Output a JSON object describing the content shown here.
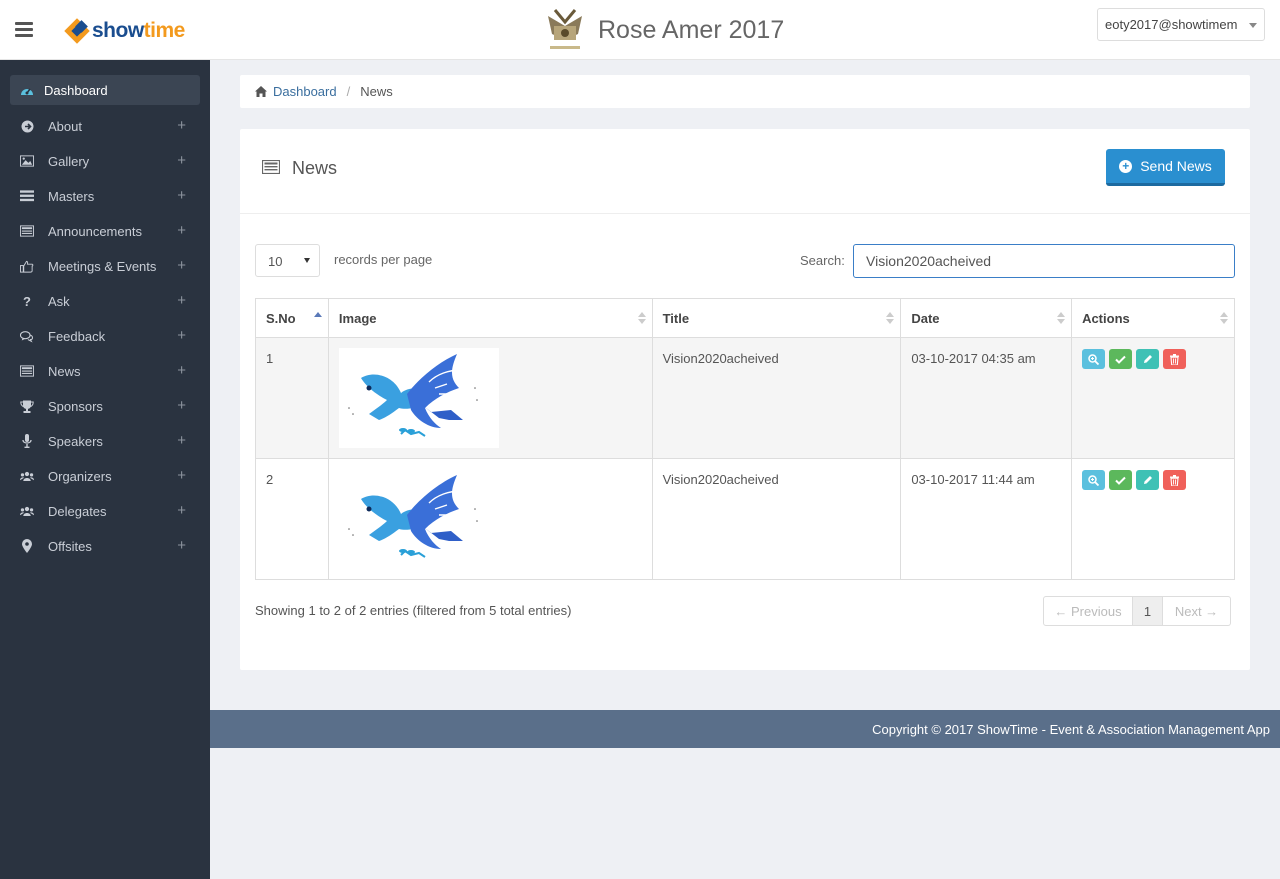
{
  "header": {
    "logo_text_main": "show",
    "logo_text_accent": "time",
    "event_title": "Rose Amer 2017",
    "user_email": "eoty2017@showtimem",
    "menu_icon": "hamburger-icon"
  },
  "sidebar": {
    "items": [
      {
        "label": "Dashboard",
        "icon": "dashboard-icon"
      },
      {
        "label": "About",
        "icon": "arrow-circle-icon"
      },
      {
        "label": "Gallery",
        "icon": "image-icon"
      },
      {
        "label": "Masters",
        "icon": "list-icon"
      },
      {
        "label": "Announcements",
        "icon": "newspaper-icon"
      },
      {
        "label": "Meetings & Events",
        "icon": "thumbs-up-icon"
      },
      {
        "label": "Ask",
        "icon": "question-icon"
      },
      {
        "label": "Feedback",
        "icon": "comments-icon"
      },
      {
        "label": "News",
        "icon": "newspaper-icon"
      },
      {
        "label": "Sponsors",
        "icon": "trophy-icon"
      },
      {
        "label": "Speakers",
        "icon": "microphone-icon"
      },
      {
        "label": "Organizers",
        "icon": "users-icon"
      },
      {
        "label": "Delegates",
        "icon": "users-icon"
      },
      {
        "label": "Offsites",
        "icon": "map-marker-icon"
      }
    ],
    "expand_symbol": "+"
  },
  "breadcrumb": {
    "home": "Dashboard",
    "separator": "/",
    "current": "News"
  },
  "panel": {
    "title": "News",
    "send_button": "Send News",
    "page_length": "10",
    "page_length_label": "records per page",
    "search_label": "Search:",
    "search_value": "Vision2020acheived"
  },
  "table": {
    "columns": [
      "S.No",
      "Image",
      "Title",
      "Date",
      "Actions"
    ],
    "rows": [
      {
        "sno": "1",
        "title": "Vision2020acheived",
        "date": "03-10-2017 04:35 am"
      },
      {
        "sno": "2",
        "title": "Vision2020acheived",
        "date": "03-10-2017 11:44 am"
      }
    ],
    "info": "Showing 1 to 2 of 2 entries (filtered from 5 total entries)",
    "pager": {
      "prev": "← Previous",
      "current": "1",
      "next": "Next →"
    }
  },
  "footer": {
    "copyright": "Copyright © 2017 ShowTime - Event & Association Management App"
  },
  "colors": {
    "sidebar_bg": "#2a3340",
    "primary_button": "#2a8fd0",
    "footer_bg": "#5a6f8a",
    "view_action": "#5bc0de",
    "approve_action": "#5cb85c",
    "edit_action": "#3fc1b5",
    "delete_action": "#f0605a"
  }
}
